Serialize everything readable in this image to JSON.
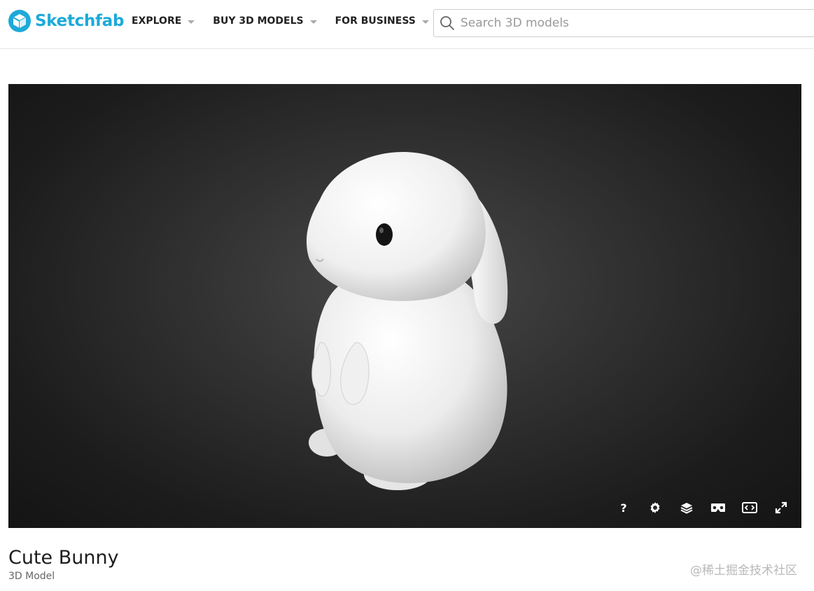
{
  "header": {
    "brand": "Sketchfab",
    "nav": [
      {
        "label": "EXPLORE"
      },
      {
        "label": "BUY 3D MODELS"
      },
      {
        "label": "FOR BUSINESS"
      }
    ],
    "search": {
      "placeholder": "Search 3D models",
      "value": ""
    }
  },
  "viewer": {
    "controls": [
      {
        "name": "help-icon",
        "glyph": "?"
      },
      {
        "name": "settings-icon"
      },
      {
        "name": "layers-icon"
      },
      {
        "name": "vr-icon"
      },
      {
        "name": "embed-icon"
      },
      {
        "name": "fullscreen-icon"
      }
    ]
  },
  "model": {
    "title": "Cute Bunny",
    "subtitle": "3D Model"
  },
  "watermark": "@稀土掘金技术社区",
  "colors": {
    "brand": "#1caad9",
    "viewer_bg": "#2b2b2b"
  }
}
